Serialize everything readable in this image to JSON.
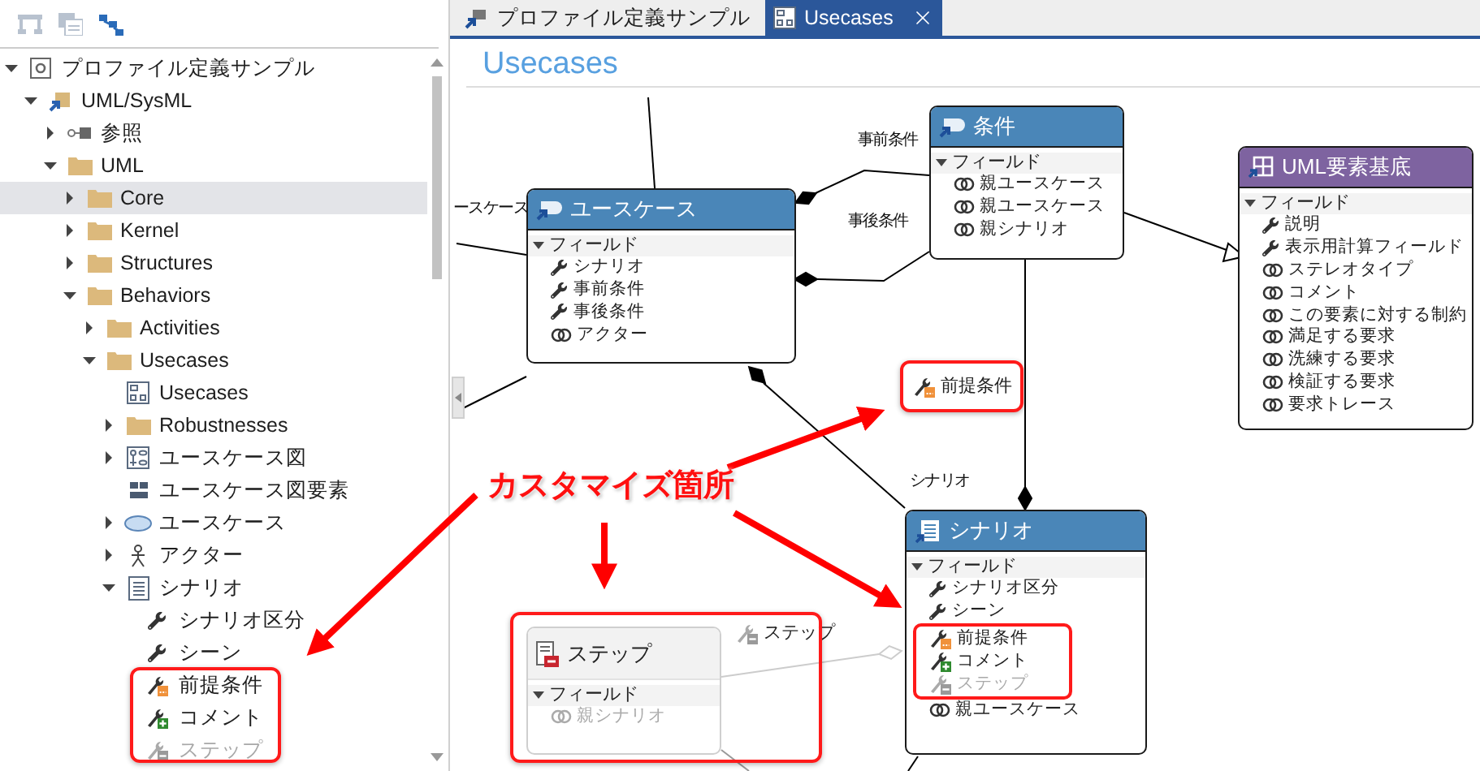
{
  "toolbar": [
    {
      "kind": "hierarchy",
      "disabled": true
    },
    {
      "kind": "windows",
      "disabled": true
    },
    {
      "kind": "nodes",
      "disabled": false
    }
  ],
  "tree": [
    {
      "label": "プロファイル定義サンプル",
      "kind": "profile",
      "expanded": true,
      "selected": false,
      "disabled": false,
      "children": [
        {
          "label": "UML/SysML",
          "kind": "package",
          "expanded": true,
          "selected": false,
          "disabled": false,
          "children": [
            {
              "label": "参照",
              "kind": "reference",
              "expanded": false,
              "selected": false,
              "disabled": false
            },
            {
              "label": "UML",
              "kind": "folder",
              "expanded": true,
              "selected": false,
              "disabled": false,
              "children": [
                {
                  "label": "Core",
                  "kind": "folder",
                  "expanded": false,
                  "selected": true,
                  "disabled": false
                },
                {
                  "label": "Kernel",
                  "kind": "folder",
                  "expanded": false,
                  "selected": false,
                  "disabled": false
                },
                {
                  "label": "Structures",
                  "kind": "folder",
                  "expanded": false,
                  "selected": false,
                  "disabled": false
                },
                {
                  "label": "Behaviors",
                  "kind": "folder",
                  "expanded": true,
                  "selected": false,
                  "disabled": false,
                  "children": [
                    {
                      "label": "Activities",
                      "kind": "folder",
                      "expanded": false,
                      "selected": false,
                      "disabled": false
                    },
                    {
                      "label": "Usecases",
                      "kind": "folder",
                      "expanded": true,
                      "selected": false,
                      "disabled": false,
                      "children": [
                        {
                          "label": "Usecases",
                          "kind": "diagram",
                          "selected": false,
                          "disabled": false
                        },
                        {
                          "label": "Robustnesses",
                          "kind": "folder",
                          "expanded": false,
                          "selected": false,
                          "disabled": false
                        },
                        {
                          "label": "ユースケース図",
                          "kind": "diagram-type",
                          "expanded": false,
                          "selected": false,
                          "disabled": false
                        },
                        {
                          "label": "ユースケース図要素",
                          "kind": "element-type",
                          "selected": false,
                          "disabled": false
                        },
                        {
                          "label": "ユースケース",
                          "kind": "usecase",
                          "expanded": false,
                          "selected": false,
                          "disabled": false
                        },
                        {
                          "label": "アクター",
                          "kind": "actor",
                          "expanded": false,
                          "selected": false,
                          "disabled": false
                        },
                        {
                          "label": "シナリオ",
                          "kind": "document",
                          "expanded": true,
                          "selected": false,
                          "disabled": false,
                          "children": [
                            {
                              "label": "シナリオ区分",
                              "kind": "attribute",
                              "selected": false,
                              "disabled": false
                            },
                            {
                              "label": "シーン",
                              "kind": "attribute",
                              "selected": false,
                              "disabled": false
                            },
                            {
                              "label": "前提条件",
                              "kind": "custom-orange",
                              "selected": false,
                              "disabled": false
                            },
                            {
                              "label": "コメント",
                              "kind": "custom-green",
                              "selected": false,
                              "disabled": false
                            },
                            {
                              "label": "ステップ",
                              "kind": "custom-gray",
                              "selected": false,
                              "disabled": true
                            }
                          ]
                        }
                      ]
                    }
                  ]
                }
              ]
            }
          ]
        }
      ]
    }
  ],
  "tabs": [
    {
      "label": "プロファイル定義サンプル",
      "kind": "profile",
      "selected": false,
      "closable": false
    },
    {
      "label": "Usecases",
      "kind": "diagram",
      "selected": true,
      "closable": true
    }
  ],
  "diagram": {
    "title": "Usecases",
    "nodes": [
      {
        "title": "条件",
        "kind": "class",
        "color": "#4a86b8",
        "ghost": false,
        "fields_heading": "フィールド",
        "fields": [
          {
            "label": "親ユースケース",
            "kind": "reference",
            "disabled": false,
            "highlighted": false
          },
          {
            "label": "親ユースケース",
            "kind": "reference",
            "disabled": false,
            "highlighted": false
          },
          {
            "label": "親シナリオ",
            "kind": "reference",
            "disabled": false,
            "highlighted": false
          }
        ]
      },
      {
        "title": "ユースケース",
        "kind": "class",
        "color": "#4a86b8",
        "ghost": false,
        "fields_heading": "フィールド",
        "fields": [
          {
            "label": "シナリオ",
            "kind": "attribute",
            "disabled": false,
            "highlighted": false
          },
          {
            "label": "事前条件",
            "kind": "attribute",
            "disabled": false,
            "highlighted": false
          },
          {
            "label": "事後条件",
            "kind": "attribute",
            "disabled": false,
            "highlighted": false
          },
          {
            "label": "アクター",
            "kind": "reference",
            "disabled": false,
            "highlighted": false
          }
        ]
      },
      {
        "title": "UML要素基底",
        "kind": "base",
        "color": "#7e63a0",
        "ghost": false,
        "fields_heading": "フィールド",
        "fields": [
          {
            "label": "説明",
            "kind": "attribute",
            "disabled": false,
            "highlighted": false
          },
          {
            "label": "表示用計算フィールド",
            "kind": "attribute",
            "disabled": false,
            "highlighted": false
          },
          {
            "label": "ステレオタイプ",
            "kind": "reference",
            "disabled": false,
            "highlighted": false
          },
          {
            "label": "コメント",
            "kind": "reference",
            "disabled": false,
            "highlighted": false
          },
          {
            "label": "この要素に対する制約",
            "kind": "reference",
            "disabled": false,
            "highlighted": false
          },
          {
            "label": "満足する要求",
            "kind": "reference",
            "disabled": false,
            "highlighted": false
          },
          {
            "label": "洗練する要求",
            "kind": "reference",
            "disabled": false,
            "highlighted": false
          },
          {
            "label": "検証する要求",
            "kind": "reference",
            "disabled": false,
            "highlighted": false
          },
          {
            "label": "要求トレース",
            "kind": "reference",
            "disabled": false,
            "highlighted": false
          }
        ]
      },
      {
        "title": "ステップ",
        "kind": "document-minus",
        "color": "#f2f2f2",
        "ghost": true,
        "fields_heading": "フィールド",
        "fields": [
          {
            "label": "親シナリオ",
            "kind": "reference",
            "disabled": true,
            "highlighted": false
          }
        ]
      },
      {
        "title": "シナリオ",
        "kind": "document",
        "color": "#4a86b8",
        "ghost": false,
        "fields_heading": "フィールド",
        "fields": [
          {
            "label": "シナリオ区分",
            "kind": "attribute",
            "disabled": false,
            "highlighted": false
          },
          {
            "label": "シーン",
            "kind": "attribute",
            "disabled": false,
            "highlighted": false
          },
          {
            "label": "前提条件",
            "kind": "custom-orange",
            "disabled": false,
            "highlighted": true
          },
          {
            "label": "コメント",
            "kind": "custom-green",
            "disabled": false,
            "highlighted": true
          },
          {
            "label": "ステップ",
            "kind": "custom-gray",
            "disabled": true,
            "highlighted": true
          },
          {
            "label": "親ユースケース",
            "kind": "reference",
            "disabled": false,
            "highlighted": false
          }
        ]
      }
    ],
    "edge_labels": [
      "ースケース",
      "事前条件",
      "事後条件",
      "シナリオ"
    ],
    "callouts": [
      {
        "label": "前提条件",
        "kind": "custom-orange"
      },
      {
        "label": "ステップ",
        "kind": "custom-gray"
      }
    ],
    "annotation": "カスタマイズ箇所"
  }
}
